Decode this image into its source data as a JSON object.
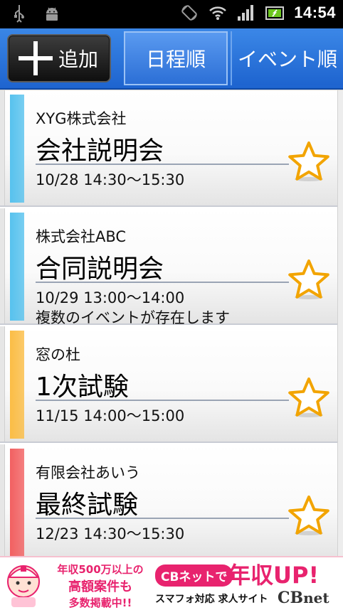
{
  "status_bar": {
    "clock": "14:54",
    "icons": [
      "usb-icon",
      "android-icon",
      "rotate-icon",
      "wifi-icon",
      "signal-icon",
      "battery-icon"
    ]
  },
  "toolbar": {
    "add_label": "追加",
    "tabs": [
      {
        "label": "日程順",
        "selected": true
      },
      {
        "label": "イベント順",
        "selected": false
      }
    ]
  },
  "events": [
    {
      "company": "XYG株式会社",
      "title": "会社説明会",
      "time": "10/28 14:30～15:30",
      "note": "",
      "color": "#57c2ee"
    },
    {
      "company": "株式会社ABC",
      "title": "合同説明会",
      "time": "10/29 13:00～14:00",
      "note": "複数のイベントが存在します",
      "color": "#57c2ee"
    },
    {
      "company": "窓の杜",
      "title": "1次試験",
      "time": "11/15 14:00～15:00",
      "note": "",
      "color": "#fbbd45"
    },
    {
      "company": "有限会社あいう",
      "title": "最終試験",
      "time": "12/23 14:30～15:30",
      "note": "",
      "color": "#f26061"
    }
  ],
  "ad": {
    "line1": "年収500万以上の",
    "line2": "高額案件も",
    "line3": "多数掲載中!!",
    "badge": "CBネットで",
    "headline": "年収UP!",
    "subline": "スマフォ対応 求人サイト",
    "brand_cb": "CB",
    "brand_net": "net",
    "accent": "#e8236e"
  }
}
